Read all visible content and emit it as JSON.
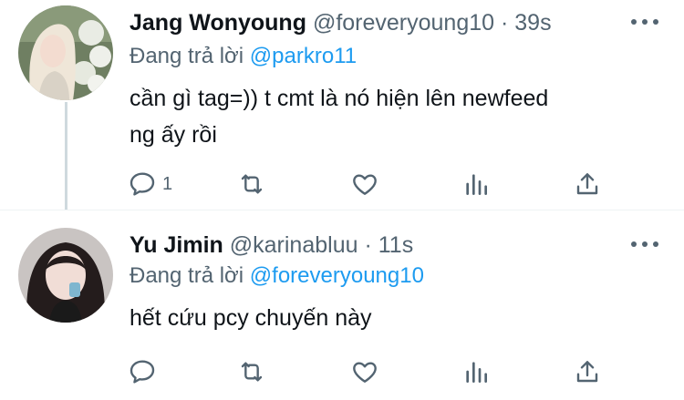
{
  "tweets": [
    {
      "name": "Jang Wonyoung",
      "handle": "@foreveryoung10",
      "separator": "·",
      "time": "39s",
      "replying_label": "Đang trả lời",
      "replying_to": "@parkro11",
      "text_lines": [
        "cần gì tag=)) t cmt là nó hiện lên newfeed",
        "ng ấy rồi"
      ],
      "reply_count": "1",
      "avatar": "profile-photo"
    },
    {
      "name": "Yu Jimin",
      "handle": "@karinabluu",
      "separator": "·",
      "time": "11s",
      "replying_label": "Đang trả lời",
      "replying_to": "@foreveryoung10",
      "text_lines": [
        "hết cứu pcy chuyến này"
      ],
      "reply_count": "",
      "avatar": "profile-photo"
    }
  ],
  "icons": {
    "reply": "speech-bubble-icon",
    "retweet": "retweet-arrows-icon",
    "like": "heart-icon",
    "analytics": "bar-chart-icon",
    "share": "upload-arrow-icon",
    "more": "three-dots-icon"
  },
  "colors": {
    "text": "#0f1419",
    "secondary": "#536471",
    "accent": "#1d9bf0",
    "thread_line": "#cfd9de"
  }
}
